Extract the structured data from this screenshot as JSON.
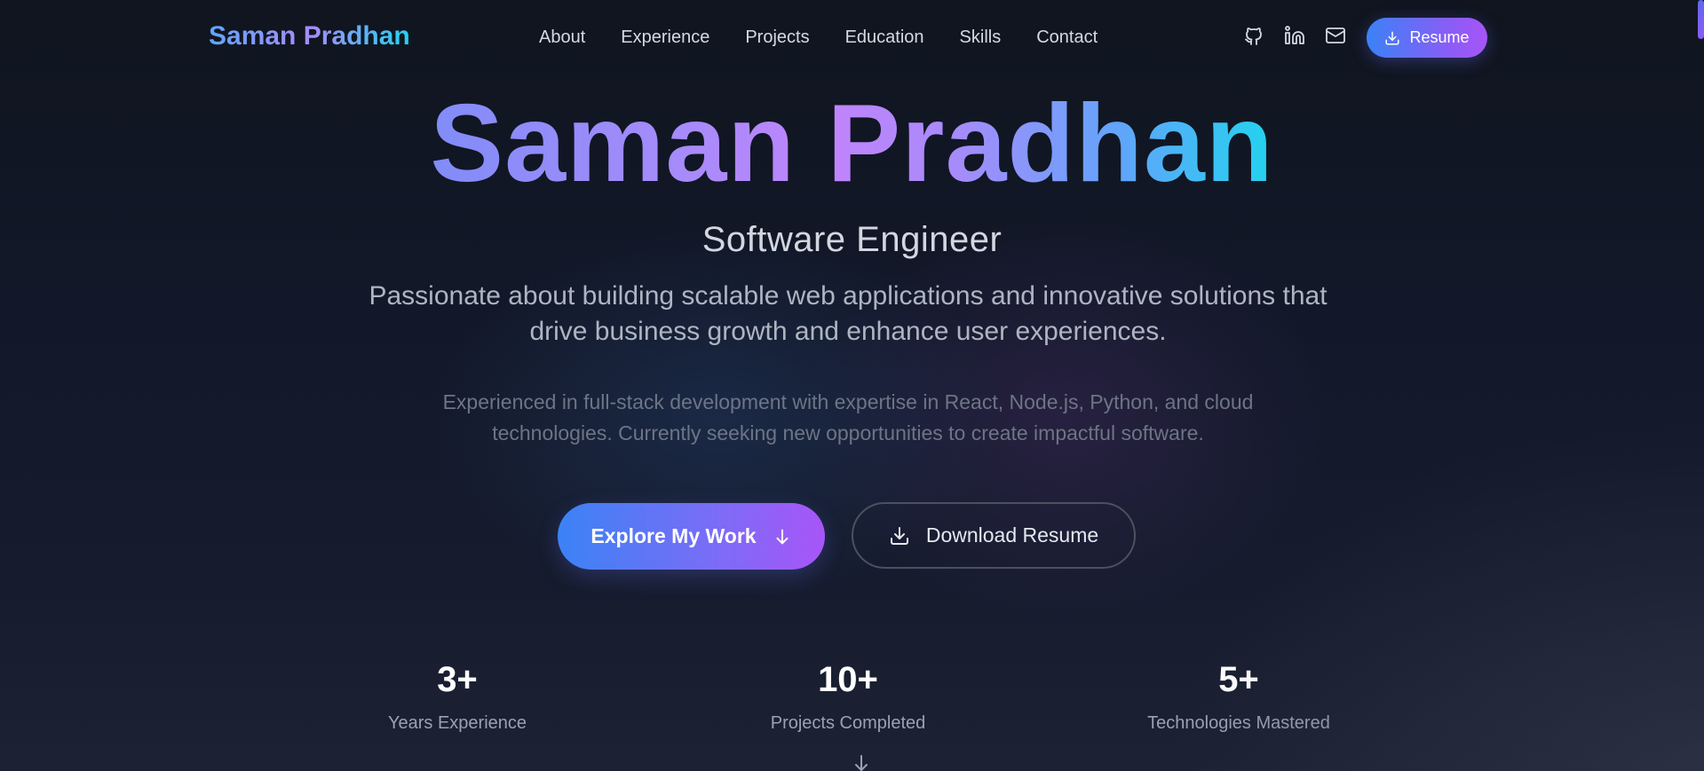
{
  "brand": {
    "name": "Saman Pradhan"
  },
  "nav": {
    "links": [
      "About",
      "Experience",
      "Projects",
      "Education",
      "Skills",
      "Contact"
    ],
    "icons": [
      "github-icon",
      "linkedin-icon",
      "mail-icon"
    ],
    "resume_label": "Resume"
  },
  "hero": {
    "title": "Saman Pradhan",
    "subtitle": "Software Engineer",
    "tagline": "Passionate about building scalable web applications and innovative solutions that drive business growth and enhance user experiences.",
    "description": "Experienced in full-stack development with expertise in React, Node.js, Python, and cloud technologies. Currently seeking new opportunities to create impactful software."
  },
  "cta": {
    "primary_label": "Explore My Work",
    "secondary_label": "Download Resume"
  },
  "stats": [
    {
      "value": "3+",
      "label": "Years Experience"
    },
    {
      "value": "10+",
      "label": "Projects Completed"
    },
    {
      "value": "5+",
      "label": "Technologies Mastered"
    }
  ],
  "colors": {
    "background": "#111626",
    "accent_blue": "#3b82f6",
    "accent_purple": "#a855f7",
    "accent_cyan": "#22d3ee"
  }
}
